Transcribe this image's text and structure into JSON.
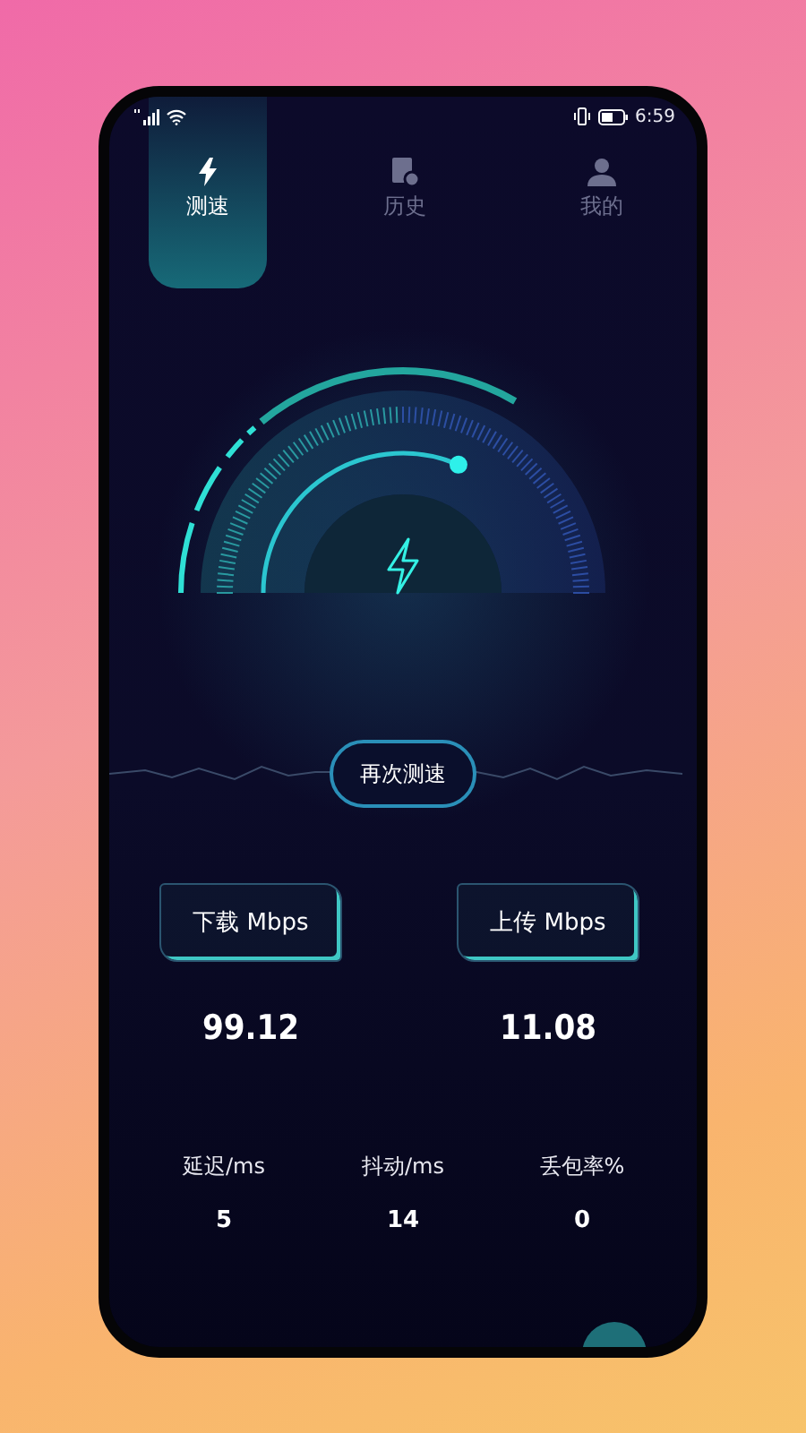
{
  "status_bar": {
    "time": "6:59"
  },
  "tabs": [
    {
      "label": "测速",
      "selected": true
    },
    {
      "label": "历史",
      "selected": false
    },
    {
      "label": "我的",
      "selected": false
    }
  ],
  "retest_button": "再次测速",
  "results": [
    {
      "label": "下载 Mbps",
      "value": "99.12"
    },
    {
      "label": "上传 Mbps",
      "value": "11.08"
    }
  ],
  "stats": [
    {
      "label": "延迟/ms",
      "value": "5"
    },
    {
      "label": "抖动/ms",
      "value": "14"
    },
    {
      "label": "丢包率%",
      "value": "0"
    }
  ]
}
